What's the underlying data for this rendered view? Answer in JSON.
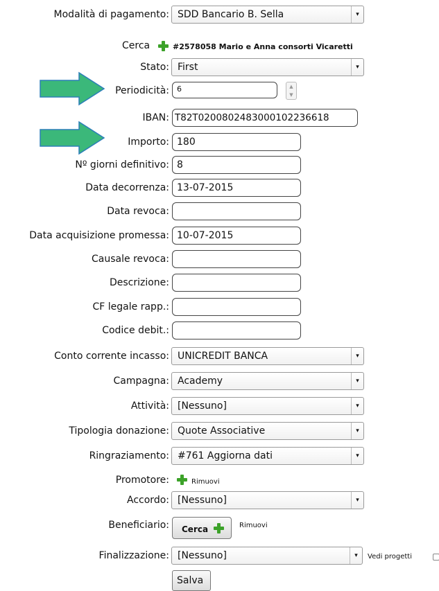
{
  "fields": {
    "modalita": {
      "label": "Modalità di pagamento:",
      "value": "SDD Bancario B. Sella"
    },
    "cerca": {
      "label": "Cerca",
      "record": "#2578058 Mario e Anna consorti Vicaretti"
    },
    "stato": {
      "label": "Stato:",
      "value": "First"
    },
    "periodicita": {
      "label": "Periodicità:",
      "value": "6"
    },
    "iban": {
      "label": "IBAN:",
      "value": "T82T0200802483000102236618"
    },
    "importo": {
      "label": "Importo:",
      "value": "180"
    },
    "giorni": {
      "label": "Nº giorni definitivo:",
      "value": "8"
    },
    "decorrenza": {
      "label": "Data decorrenza:",
      "value": "13-07-2015"
    },
    "revoca": {
      "label": "Data revoca:",
      "value": ""
    },
    "acquisizione": {
      "label": "Data acquisizione promessa:",
      "value": "10-07-2015"
    },
    "causale": {
      "label": "Causale revoca:",
      "value": ""
    },
    "descrizione": {
      "label": "Descrizione:",
      "value": ""
    },
    "cf": {
      "label": "CF legale rapp.:",
      "value": ""
    },
    "codice": {
      "label": "Codice debit.:",
      "value": ""
    },
    "conto": {
      "label": "Conto corrente incasso:",
      "value": "UNICREDIT BANCA"
    },
    "campagna": {
      "label": "Campagna:",
      "value": "Academy"
    },
    "attivita": {
      "label": "Attività:",
      "value": "[Nessuno]"
    },
    "tipologia": {
      "label": "Tipologia donazione:",
      "value": "Quote Associative"
    },
    "ringraziamento": {
      "label": "Ringraziamento:",
      "value": "#761 Aggiorna dati"
    },
    "promotore": {
      "label": "Promotore:",
      "remove": "Rimuovi"
    },
    "accordo": {
      "label": "Accordo:",
      "value": "[Nessuno]"
    },
    "beneficiario": {
      "label": "Beneficiario:",
      "button": "Cerca",
      "remove": "Rimuovi"
    },
    "finalizzazione": {
      "label": "Finalizzazione:",
      "value": "[Nessuno]",
      "vedi": "Vedi progetti"
    }
  },
  "save_label": "Salva",
  "colors": {
    "arrow": "#3bb87a",
    "plus": "#3ca229"
  }
}
